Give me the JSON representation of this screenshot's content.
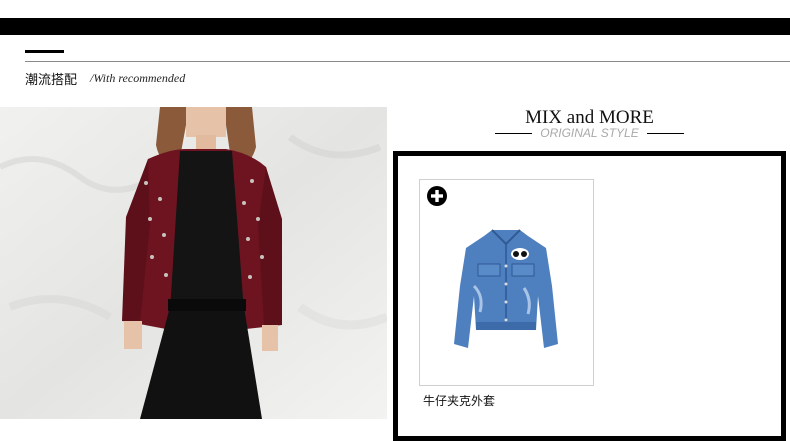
{
  "section": {
    "title": "潮流搭配",
    "subtitle": "/With recommended"
  },
  "mix": {
    "title": "MIX and MORE",
    "subtitle": "ORIGINAL STYLE"
  },
  "product": {
    "name": "牛仔夹克外套",
    "add_icon": "plus-circle-icon"
  },
  "colors": {
    "cardigan": "#6e1420",
    "denim": "#4e7fbf",
    "frame": "#000000"
  }
}
